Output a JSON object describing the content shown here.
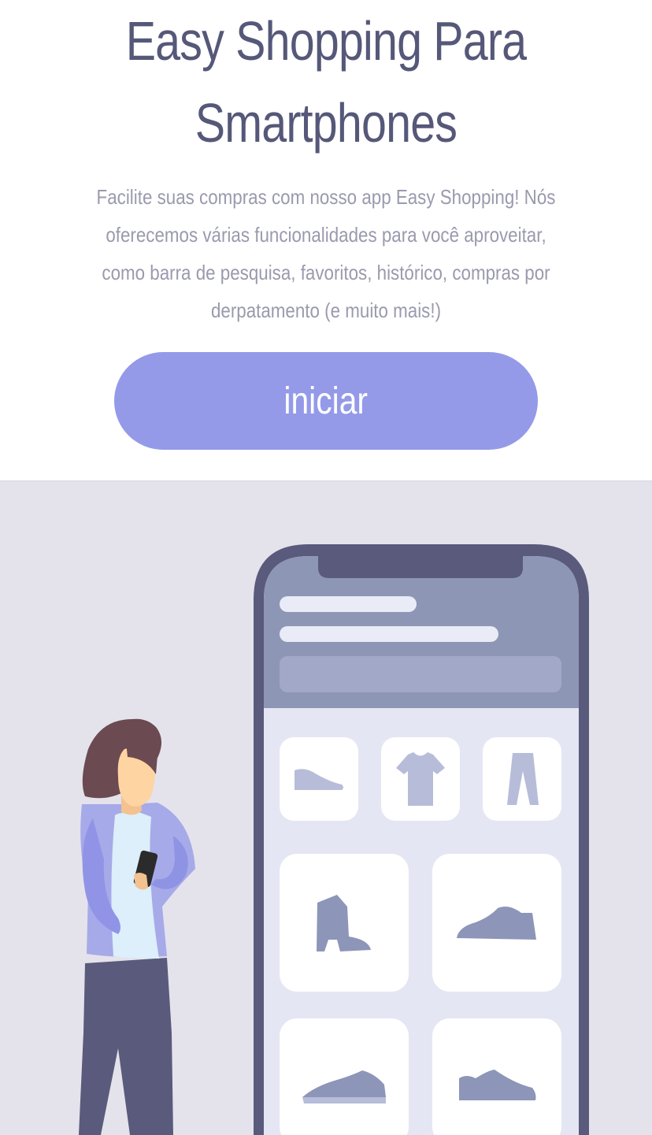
{
  "hero": {
    "title_line1": "Easy Shopping Para",
    "title_line2": "Smartphones",
    "description": "Facilite suas compras com nosso app Easy Shopping! Nós oferecemos várias funcionalidades para você aproveitar, como barra de pesquisa, favoritos, histórico, compras por derpatamento (e muito mais!)",
    "start_button_label": "iniciar"
  },
  "colors": {
    "title": "#565879",
    "description": "#9a9aae",
    "button": "#949ae8",
    "illustration_background": "#e4e3ec",
    "phone_frame": "#5a5a7c"
  },
  "illustration": {
    "subject": "woman holding smartphone next to large phone showing shopping app",
    "category_icons": [
      "shoe-icon",
      "tshirt-icon",
      "pants-icon"
    ],
    "product_icons": [
      "boot-icon",
      "sneaker-icon",
      "sneaker-icon",
      "sneaker-icon"
    ]
  }
}
